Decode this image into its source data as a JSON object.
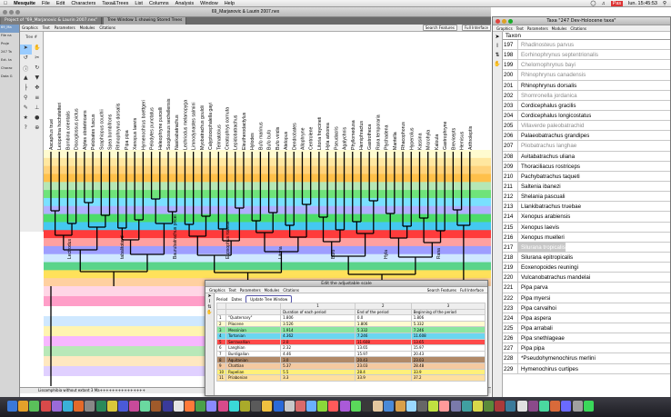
{
  "menubar": {
    "apple": "",
    "app": "Mesquite",
    "items": [
      "File",
      "Edit",
      "Characters",
      "Taxa&Trees",
      "List",
      "Columns",
      "Analysis",
      "Window",
      "Help"
    ],
    "clock": "lun. 15:45:53",
    "input_badge": "Pas"
  },
  "main_window": {
    "title": "69_Marjanovic & Laurin 2007.nex",
    "tabs": [
      "Project of \"69_Marjanovic & Laurin 2007.nex\"",
      "Tree Window 1 showing Stored Trees"
    ],
    "left_items": [
      "69_Ma",
      "File na",
      "Proje",
      "247 Ta",
      "Ext. ta",
      "Charac",
      "Data G"
    ],
    "toolbar": {
      "graphics": "Graphics",
      "text": "Text",
      "parameters": "Parameters",
      "modules": "Modules",
      "citations": "Citations",
      "search_features": "Search Features",
      "full_interface": "Full Interface"
    },
    "tree_label": "Tree #",
    "status": "Lissamphibia without extant 3 Ma+++++++++++++++"
  },
  "scale_dialog": {
    "title": "Edit the adjustable scale",
    "tabs": [
      "Graphics",
      "Text",
      "Parameters",
      "Modules",
      "Citations"
    ],
    "search_features": "Search Features",
    "full_interface": "Full Interface",
    "period_label": "Period",
    "dates_label": "Dates",
    "update_button": "Update Tree Window",
    "col_numbers": [
      "1",
      "2",
      "3"
    ],
    "headers": [
      "Duration of each period",
      "End of the period",
      "Beginning of the period"
    ],
    "rows": [
      {
        "n": "1",
        "name": "\"Quaternary\"",
        "d": "1.806",
        "e": "0.0",
        "b": "1.806",
        "color": "#ffffff"
      },
      {
        "n": "2",
        "name": "Pliocene",
        "d": "3.526",
        "e": "1.806",
        "b": "5.332",
        "color": "#fffbd0"
      },
      {
        "n": "3",
        "name": "Messinian",
        "d": "1.914",
        "e": "5.332",
        "b": "7.246",
        "color": "#8ae6a0"
      },
      {
        "n": "4",
        "name": "Tortonian",
        "d": "4.362",
        "e": "7.246",
        "b": "11.608",
        "color": "#6bd6f0"
      },
      {
        "n": "5",
        "name": "Serravallian",
        "d": "2.0",
        "e": "11.608",
        "b": "13.65",
        "color": "#ff4a4a"
      },
      {
        "n": "6",
        "name": "Langhian",
        "d": "2.32",
        "e": "13.65",
        "b": "15.97",
        "color": "#ffffff"
      },
      {
        "n": "7",
        "name": "Burdigalian",
        "d": "4.46",
        "e": "15.97",
        "b": "20.43",
        "color": "#ffffff"
      },
      {
        "n": "8",
        "name": "Aquitanian",
        "d": "3.0",
        "e": "20.43",
        "b": "23.03",
        "color": "#b08968"
      },
      {
        "n": "9",
        "name": "Chattian",
        "d": "5.37",
        "e": "23.03",
        "b": "28.48",
        "color": "#f4c9a0"
      },
      {
        "n": "10",
        "name": "Rupelian",
        "d": "5.5",
        "e": "28.4",
        "b": "33.9",
        "color": "#fff07a"
      },
      {
        "n": "11",
        "name": "Priabonian",
        "d": "3.3",
        "e": "33.9",
        "b": "37.2",
        "color": "#ffe0a0"
      }
    ]
  },
  "taxa_window": {
    "title": "Taxa \"247 Dev-Holocene taxa\"",
    "tabs": [
      "Graphics",
      "Text",
      "Parameters",
      "Modules",
      "Citations"
    ],
    "header": "Taxon",
    "rows": [
      {
        "n": "197",
        "name": "Rhadinosteus parvus",
        "extinct": true
      },
      {
        "n": "198",
        "name": "Eorhinophrynus septentrionalis",
        "extinct": true
      },
      {
        "n": "199",
        "name": "Chelomophrynus bayi",
        "extinct": true
      },
      {
        "n": "200",
        "name": "Rhinophrynus canadensis",
        "extinct": true
      },
      {
        "n": "201",
        "name": "Rhinophrynus dorsalis",
        "extinct": false
      },
      {
        "n": "202",
        "name": "Shomronella jordanica",
        "extinct": true
      },
      {
        "n": "203",
        "name": "Cordicephalus gracilis",
        "extinct": false
      },
      {
        "n": "204",
        "name": "Cordicephalus longicostatus",
        "extinct": false
      },
      {
        "n": "205",
        "name": "Villaverde paleobatrachid",
        "extinct": true
      },
      {
        "n": "206",
        "name": "Palaeobatrachus grandipes",
        "extinct": false
      },
      {
        "n": "207",
        "name": "Pliobatrachus langhae",
        "extinct": true
      },
      {
        "n": "208",
        "name": "Avitabatrachus uliana",
        "extinct": false
      },
      {
        "n": "209",
        "name": "Thoraciliacus rostriceps",
        "extinct": false
      },
      {
        "n": "210",
        "name": "Pachybatrachus taqueti",
        "extinct": false
      },
      {
        "n": "211",
        "name": "Saltenia ibanezi",
        "extinct": false
      },
      {
        "n": "212",
        "name": "Shelania pascuali",
        "extinct": false
      },
      {
        "n": "213",
        "name": "Llankibatrachus truebae",
        "extinct": false
      },
      {
        "n": "214",
        "name": "Xenopus arabiensis",
        "extinct": false
      },
      {
        "n": "215",
        "name": "Xenopus laevis",
        "extinct": false
      },
      {
        "n": "216",
        "name": "Xenopus muelleri",
        "extinct": false
      },
      {
        "n": "217",
        "name": "Silurana tropicalis",
        "extinct": false,
        "selected": true
      },
      {
        "n": "218",
        "name": "Silurana epitropicalis",
        "extinct": false
      },
      {
        "n": "219",
        "name": "Eoxenopoides reuningi",
        "extinct": false
      },
      {
        "n": "220",
        "name": "Vulcanobatrachus mandelai",
        "extinct": false
      },
      {
        "n": "221",
        "name": "Pipa parva",
        "extinct": false
      },
      {
        "n": "222",
        "name": "Pipa myersi",
        "extinct": false
      },
      {
        "n": "223",
        "name": "Pipa carvalhoi",
        "extinct": false
      },
      {
        "n": "224",
        "name": "Pipa aspera",
        "extinct": false
      },
      {
        "n": "225",
        "name": "Pipa arrabali",
        "extinct": false
      },
      {
        "n": "226",
        "name": "Pipa snethlageae",
        "extinct": false
      },
      {
        "n": "227",
        "name": "Pipa pipa",
        "extinct": false
      },
      {
        "n": "228",
        "name": "*Pseudohymenochirus merlini",
        "extinct": false
      },
      {
        "n": "229",
        "name": "Hymenochirus curtipes",
        "extinct": false
      }
    ]
  },
  "tree": {
    "band_colors": [
      "#fffbd0",
      "#ffe7a0",
      "#ffd27a",
      "#ffc04a",
      "#b5e7b5",
      "#6fe37a",
      "#7ae0ff",
      "#b0b0ff",
      "#4cdc6a",
      "#44c8f0",
      "#ff3b3b",
      "#ffa0a0",
      "#9e9eff",
      "#cfe8ff",
      "#5ad48a",
      "#ffe15a",
      "#ffd0a0"
    ],
    "lower_colors": [
      "#ffd6e6",
      "#ff9ec8",
      "#ffffff",
      "#cfe8ff",
      "#fff4b0",
      "#f7b7ff",
      "#b8e8b8",
      "#ffe8c0",
      "#e0d0ff",
      "#ffffff"
    ],
    "node_labels": [
      "Lectrodus",
      "tabalitotavd",
      "Baurubatrachus pricei",
      "Eupsophus roseus",
      "Litoria",
      "Bufo",
      "Hyla",
      "Rana"
    ],
    "tip_labels": [
      "Ascaphus truei",
      "Leiopelma hochstetteri",
      "Bombina orientalis",
      "Discoglossus pictus",
      "Alytes obstetricans",
      "Pelobates fuscus",
      "Scaphiopus couchii",
      "Spea bombifrons",
      "Rhinophrynus dorsalis",
      "Pipa pipa",
      "Xenopus laevis",
      "Hymenochirus boettgeri",
      "Pelodytes punctatus",
      "Heleophryne purcelli",
      "Sooglossus sechellensis",
      "Nasikabatrachus",
      "Lechriodus melanopyga",
      "Limnodynastes salmini",
      "Myobatrachus gouldii",
      "Calyptocephalella gayi",
      "Telmatobius",
      "Ceratophrys cornuta",
      "Lepidobatrachus",
      "Eleutherodactylus",
      "Hylodes",
      "Bufo marinus",
      "Bufo bufo",
      "Bufo viridis",
      "Atelopus",
      "Dendrobates",
      "Allophryne",
      "Centrolene",
      "Litoria freycineti",
      "Hyla arborea",
      "Pseudacris",
      "Agalychnis",
      "Phyllomedusa",
      "Hemiphractus",
      "Gastrotheca",
      "Rana temporaria",
      "Ptychadena",
      "Mantella",
      "Rhacophorus",
      "Hyperolius",
      "Kassina",
      "Microhyla",
      "Kaloula",
      "Gastrophryne",
      "Brevicepts",
      "Hemisus",
      "Arthroleptis"
    ]
  }
}
